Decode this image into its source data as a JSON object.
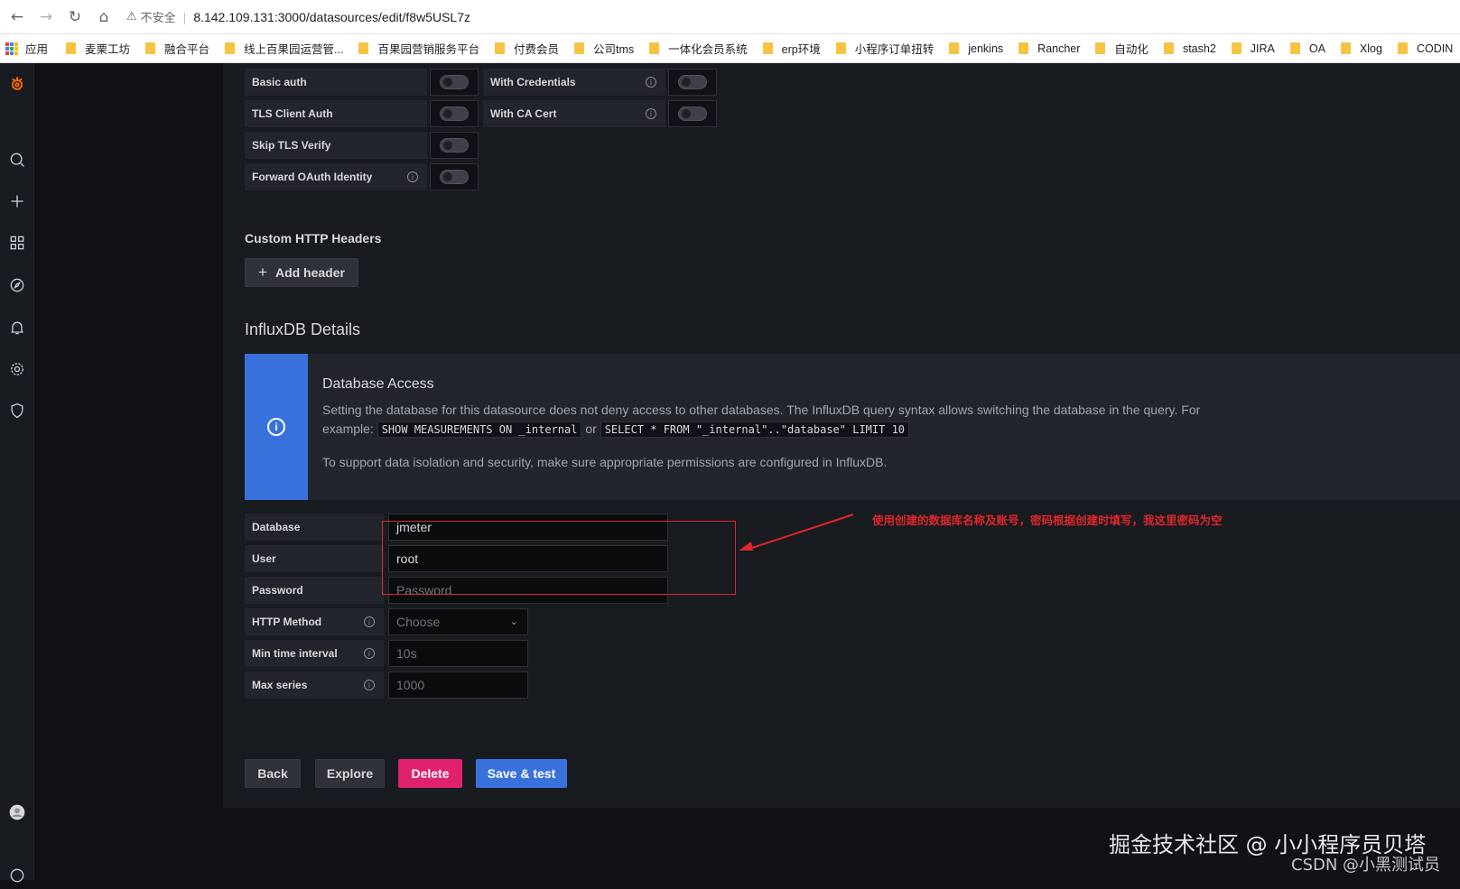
{
  "browser": {
    "security_label": "不安全",
    "url": "8.142.109.131:3000/datasources/edit/f8w5USL7z",
    "apps_label": "应用",
    "bookmarks": [
      "麦栗工坊",
      "融合平台",
      "线上百果园运营管...",
      "百果园营销服务平台",
      "付费会员",
      "公司tms",
      "一体化会员系统",
      "erp环境",
      "小程序订单扭转",
      "jenkins",
      "Rancher",
      "自动化",
      "stash2",
      "JIRA",
      "OA",
      "Xlog",
      "CODIN"
    ]
  },
  "auth": {
    "basic_auth": "Basic auth",
    "with_credentials": "With Credentials",
    "tls_client_auth": "TLS Client Auth",
    "with_ca_cert": "With CA Cert",
    "skip_tls_verify": "Skip TLS Verify",
    "forward_oauth": "Forward OAuth Identity"
  },
  "headers": {
    "title": "Custom HTTP Headers",
    "add_button": "Add header"
  },
  "influx": {
    "title": "InfluxDB Details",
    "alert_title": "Database Access",
    "alert_text_1": "Setting the database for this datasource does not deny access to other databases. The InfluxDB query syntax allows switching the database in the query. For",
    "alert_example": "example:",
    "code_1": "SHOW MEASUREMENTS ON _internal",
    "or": "or",
    "code_2": "SELECT * FROM \"_internal\"..\"database\" LIMIT 10",
    "alert_text_2": "To support data isolation and security, make sure appropriate permissions are configured in InfluxDB."
  },
  "fields": {
    "database_label": "Database",
    "database_value": "jmeter",
    "user_label": "User",
    "user_value": "root",
    "password_label": "Password",
    "password_placeholder": "Password",
    "http_method_label": "HTTP Method",
    "http_method_placeholder": "Choose",
    "min_time_label": "Min time interval",
    "min_time_placeholder": "10s",
    "max_series_label": "Max series",
    "max_series_placeholder": "1000"
  },
  "actions": {
    "back": "Back",
    "explore": "Explore",
    "delete": "Delete",
    "save_test": "Save & test"
  },
  "annotation": "使用创建的数据库名称及账号，密码根据创建时填写，我这里密码为空",
  "watermark": "掘金技术社区 @ 小小程序员贝塔",
  "watermark_2": "CSDN @小黑测试员",
  "colors": {
    "primary": "#3871dc",
    "danger": "#e0226e",
    "annotation": "#e0262b",
    "background": "#111217"
  }
}
